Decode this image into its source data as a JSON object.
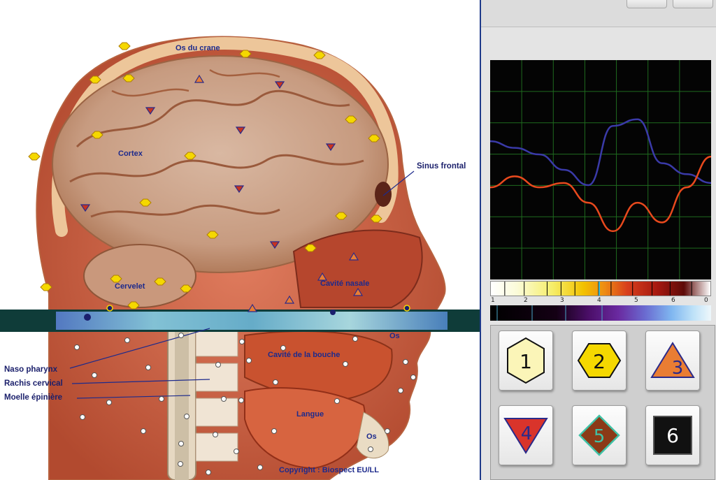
{
  "anatomy": {
    "labels": {
      "os_du_crane": "Os du crane",
      "cortex": "Cortex",
      "sinus_frontal": "Sinus frontal",
      "cervelet": "Cervelet",
      "cavite_nasale": "Cavité nasale",
      "os_upper": "Os",
      "cavite_bouche": "Cavité de la bouche",
      "naso_pharynx": "Naso pharynx",
      "rachis_cervical": "Rachis cervical",
      "moelle_epiniere": "Moelle épinière",
      "langue": "Langue",
      "os_lower": "Os",
      "copyright": "Copyright : Biospect EU/LL"
    }
  },
  "scope": {
    "grid_columns": 7,
    "grid_rows": 7,
    "series": [
      {
        "color": "#3a3aa8",
        "values": [
          0.63,
          0.6,
          0.57,
          0.5,
          0.43,
          0.7,
          0.73,
          0.53,
          0.48,
          0.44
        ]
      },
      {
        "color": "#e8491d",
        "values": [
          0.42,
          0.47,
          0.42,
          0.44,
          0.35,
          0.22,
          0.35,
          0.26,
          0.42,
          0.56
        ]
      }
    ]
  },
  "spectrum_scale": [
    "1",
    "2",
    "3",
    "4",
    "5",
    "6",
    "0"
  ],
  "colors": {
    "teal_band": "#0f3c39",
    "hex_yellow": "#f5d800",
    "hex_pale": "#fbf5b8",
    "tri_orange": "#e97d33",
    "tri_red": "#d9342b",
    "diamond_brown": "#8b3a17",
    "diamond_text": "#3fc2a6",
    "square_black": "#111111"
  },
  "buttons": [
    {
      "label": "1",
      "icon": "hexagon-pale-icon"
    },
    {
      "label": "2",
      "icon": "hexagon-yellow-icon"
    },
    {
      "label": "3",
      "icon": "triangle-up-orange-icon"
    },
    {
      "label": "4",
      "icon": "triangle-down-red-icon"
    },
    {
      "label": "5",
      "icon": "diamond-brown-icon"
    },
    {
      "label": "6",
      "icon": "square-black-icon"
    }
  ]
}
